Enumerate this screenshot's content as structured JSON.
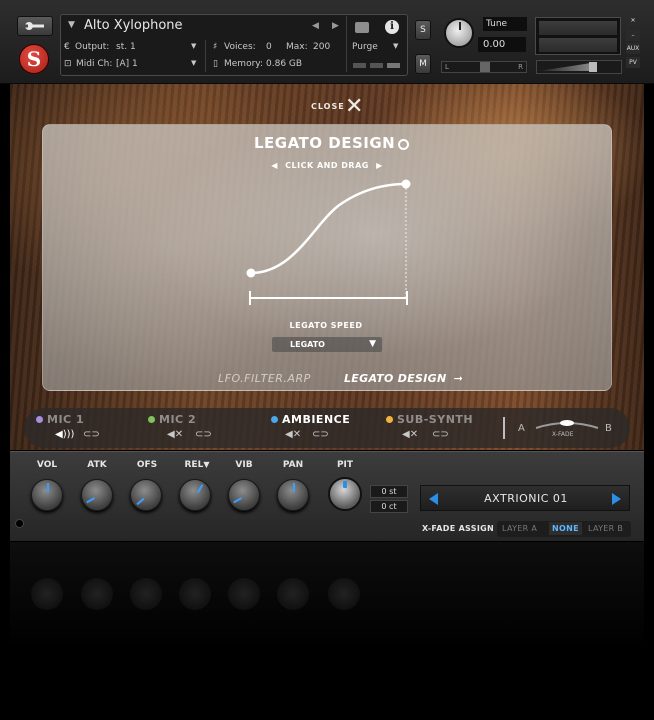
{
  "header": {
    "instrument_name": "Alto Xylophone",
    "output_label": "Output:",
    "output_value": "st. 1",
    "voices_label": "Voices:",
    "voices_value": "0",
    "max_label": "Max:",
    "max_value": "200",
    "purge_label": "Purge",
    "midi_label": "Midi Ch:",
    "midi_value": "[A]  1",
    "memory_label": "Memory:",
    "memory_value": "0.86 GB",
    "solo_label": "S",
    "mute_label": "M",
    "tune_label": "Tune",
    "tune_value": "0.00",
    "pan_l": "L",
    "pan_r": "R",
    "aux_label": "AUX",
    "pv_label": "PV"
  },
  "close": {
    "label": "CLOSE"
  },
  "legato": {
    "title": "LEGATO DESIGN",
    "instruction": "CLICK AND DRAG",
    "speed_label": "LEGATO SPEED",
    "speed_value": "LEGATO"
  },
  "pages": {
    "lfo": "LFO.FILTER.ARP",
    "legato": "LEGATO DESIGN"
  },
  "mics": [
    {
      "label": "MIC 1",
      "color": "#a98ddf"
    },
    {
      "label": "MIC 2",
      "color": "#7fc35a"
    },
    {
      "label": "AMBIENCE",
      "color": "#4aa8e8"
    },
    {
      "label": "SUB-SYNTH",
      "color": "#f0b43c"
    }
  ],
  "xfade": {
    "a": "A",
    "b": "B",
    "label": "X-FADE"
  },
  "knobs": [
    {
      "label": "VOL"
    },
    {
      "label": "ATK"
    },
    {
      "label": "OFS"
    },
    {
      "label": "REL"
    },
    {
      "label": "VIB"
    },
    {
      "label": "PAN"
    },
    {
      "label": "PIT"
    }
  ],
  "pitch": {
    "st": "0 st",
    "ct": "0 ct"
  },
  "preset": {
    "name": "AXTRIONIC 01"
  },
  "xfade_assign": {
    "label": "X-FADE ASSIGN",
    "options": [
      "LAYER A",
      "NONE",
      "LAYER B"
    ],
    "selected": "NONE"
  },
  "colors": {
    "accent_blue": "#2b8fe6",
    "selected_option": "#5fb4ff"
  }
}
